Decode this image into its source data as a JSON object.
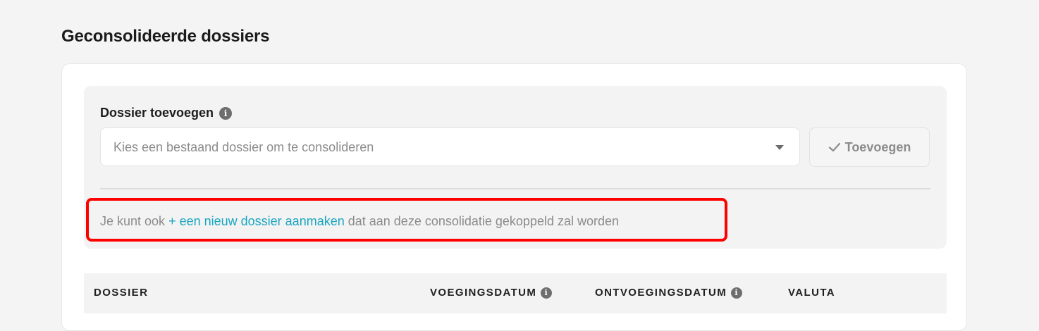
{
  "page": {
    "title": "Geconsolideerde dossiers"
  },
  "add_dossier": {
    "label": "Dossier toevoegen",
    "info_glyph": "i",
    "select_placeholder": "Kies een bestaand dossier om te consolideren",
    "button_label": "Toevoegen"
  },
  "hint": {
    "prefix": "Je kunt ook ",
    "link_text": "+ een nieuw dossier aanmaken",
    "suffix": " dat aan deze consolidatie gekoppeld zal worden"
  },
  "table": {
    "columns": [
      {
        "label": "DOSSIER",
        "has_info": false
      },
      {
        "label": "VOEGINGSDATUM",
        "has_info": true
      },
      {
        "label": "ONTVOEGINGSDATUM",
        "has_info": true
      },
      {
        "label": "VALUTA",
        "has_info": false
      }
    ]
  },
  "colors": {
    "link": "#1aa5c0",
    "annotation": "#ff0000",
    "panel": "#f3f3f3"
  },
  "icons": [
    "info-icon",
    "chevron-down-icon",
    "check-icon"
  ]
}
